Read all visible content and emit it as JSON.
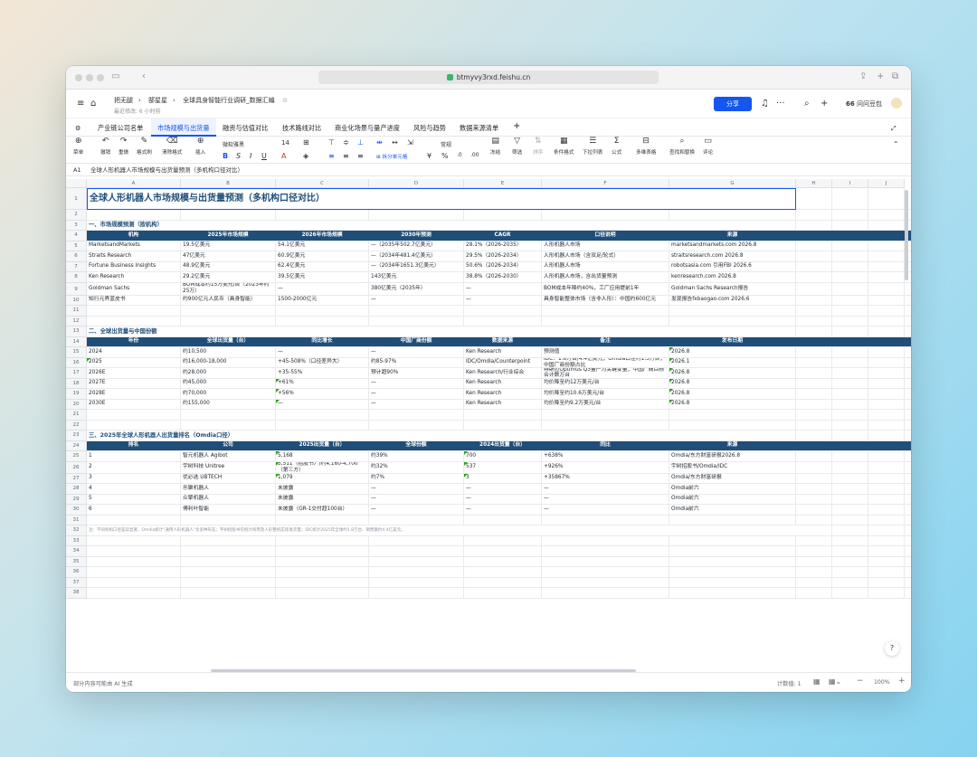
{
  "browser": {
    "url": "btmyvy3rxd.feishu.cn"
  },
  "doc": {
    "breadcrumb": [
      "把无腿",
      "郜星星",
      "全球具身智能行业调研_数据汇编"
    ],
    "last_modified": "最近修改: 6 小时前",
    "share_label": "分享",
    "user_label": "问问豆包"
  },
  "tabs": [
    "产业链公司名单",
    "市场规模与出货量",
    "融资与估值对比",
    "技术路线对比",
    "商业化场景与量产进度",
    "风险与趋势",
    "数据来源清单"
  ],
  "toolbar": {
    "items": [
      "菜单",
      "撤销",
      "重做",
      "格式刷",
      "清除格式",
      "插入"
    ],
    "font_name": "微软雅黑",
    "font_size": "14",
    "merge_label": "拆分单元格",
    "number_format": "常规",
    "right_items": [
      "冻结",
      "筛选",
      "排序",
      "条件格式",
      "下拉列表",
      "公式",
      "多维表格",
      "查找和替换",
      "评论"
    ]
  },
  "formula_bar": {
    "ref": "A1",
    "value": "全球人形机器人市场规模与出货量预测（多机构口径对比）"
  },
  "columns": [
    "A",
    "B",
    "C",
    "D",
    "E",
    "F",
    "G",
    "H",
    "I",
    "J"
  ],
  "sheet": {
    "title": "全球人形机器人市场规模与出货量预测（多机构口径对比）",
    "section1": "一、市场规模预测（按机构）",
    "table1_headers": [
      "机构",
      "2025年市场规模",
      "2026年市场规模",
      "2030年预测",
      "CAGR",
      "口径说明",
      "来源"
    ],
    "table1_rows": [
      [
        "MarketsandMarkets",
        "19.5亿美元",
        "54.1亿美元",
        "—（2035年502.7亿美元）",
        "28.1%（2026-2035）",
        "人形机器人市场",
        "marketsandmarkets.com 2026.8"
      ],
      [
        "Straits Research",
        "47亿美元",
        "60.9亿美元",
        "—（2034年481.4亿美元）",
        "29.5%（2026-2034）",
        "人形机器人市场（含双足/轮式）",
        "straitsresearch.com 2026.8"
      ],
      [
        "Fortune Business Insights",
        "48.9亿美元",
        "62.4亿美元",
        "—（2034年1651.3亿美元）",
        "50.6%（2026-2034）",
        "人形机器人市场",
        "robotsasia.com 引用FBI 2026.6"
      ],
      [
        "Ken Research",
        "29.2亿美元",
        "39.5亿美元",
        "143亿美元",
        "38.8%（2026-2030）",
        "人形机器人市场，含出货量预测",
        "kenresearch.com 2026.8"
      ],
      [
        "Goldman Sachs",
        "BOM成本约15万美元/台（2023年约25万）",
        "—",
        "380亿美元（2035年）",
        "—",
        "BOM成本年降约40%，工厂应用提前1年",
        "Goldman Sachs Research报告"
      ],
      [
        "知行元界蓝皮书",
        "约900亿元人民币（具身智能）",
        "1500-2000亿元",
        "—",
        "—",
        "具身智能整体市场（含非人形）：中国约600亿元",
        "发现报告fxbaogao.com 2026.6"
      ]
    ],
    "section2": "二、全球出货量与中国份额",
    "table2_headers": [
      "年份",
      "全球出货量（台）",
      "同比增长",
      "中国厂商份额",
      "数据来源",
      "备注",
      "发布日期"
    ],
    "table2_rows": [
      [
        "2024",
        "约10,500",
        "—",
        "—",
        "Ken Research",
        "预测值",
        "2026.8"
      ],
      [
        "2025",
        "约16,000-18,000",
        "+45-508%（口径差异大）",
        "约85-97%",
        "IDC/Omdia/Counterpoint",
        "IDC：1.8万台/4.4亿美元；Omdia口径约1.3万台；中国厂商份额占比",
        "2026.1"
      ],
      [
        "2026E",
        "约28,000",
        "+35-55%",
        "预计超90%",
        "Ken Research/行业综合",
        "特斯拉Optimus Q3量产为关键变量；中国厂商目标合计数万台",
        "2026.8"
      ],
      [
        "2027E",
        "约45,000",
        "+61%",
        "—",
        "Ken Research",
        "均价降至约12万美元/台",
        "2026.8"
      ],
      [
        "2028E",
        "约70,000",
        "+56%",
        "—",
        "Ken Research",
        "均价降至约10.6万美元/台",
        "2026.8"
      ],
      [
        "2030E",
        "约155,000",
        "—",
        "—",
        "Ken Research",
        "均价降至约9.2万美元/台",
        "2026.8"
      ]
    ],
    "section3": "三、2025年全球人形机器人出货量排名（Omdia口径）",
    "table3_headers": [
      "排名",
      "公司",
      "2025出货量（台）",
      "全球份额",
      "2024出货量（台）",
      "同比",
      "来源"
    ],
    "table3_rows": [
      [
        "1",
        "智元机器人 Agibot",
        "5,168",
        "约39%",
        "700",
        "+638%",
        "Omdia/东方财富研报2026.8"
      ],
      [
        "2",
        "宇树科技 Unitree",
        "5,511（招股书）/约4,160-4,700（第三方）",
        "约32%",
        "537",
        "+926%",
        "宇树招股书/Omdia/IDC"
      ],
      [
        "3",
        "优必选 UBTECH",
        "1,079",
        "约7%",
        "3",
        "+35867%",
        "Omdia/东方财富研报"
      ],
      [
        "4",
        "乐聚机器人",
        "未披露",
        "—",
        "—",
        "—",
        "Omdia前六"
      ],
      [
        "5",
        "众擎机器人",
        "未披露",
        "—",
        "—",
        "—",
        "Omdia前六"
      ],
      [
        "6",
        "傅利叶智能",
        "未披露（GR-1交付超100台）",
        "—",
        "—",
        "—",
        "Omdia前六"
      ]
    ],
    "note": "注：不同机构口径差异显著，Omdia统计\"通用人形机器人\"含多种形态；宇树招股书仅统计商用及人形整机实际发货量；IDC统计2025年全球约1.8万台、销售额约4.4亿美元。"
  },
  "status": {
    "left": "部分内容可能由 AI 生成",
    "count": "计数值: 1",
    "zoom": "100%"
  }
}
